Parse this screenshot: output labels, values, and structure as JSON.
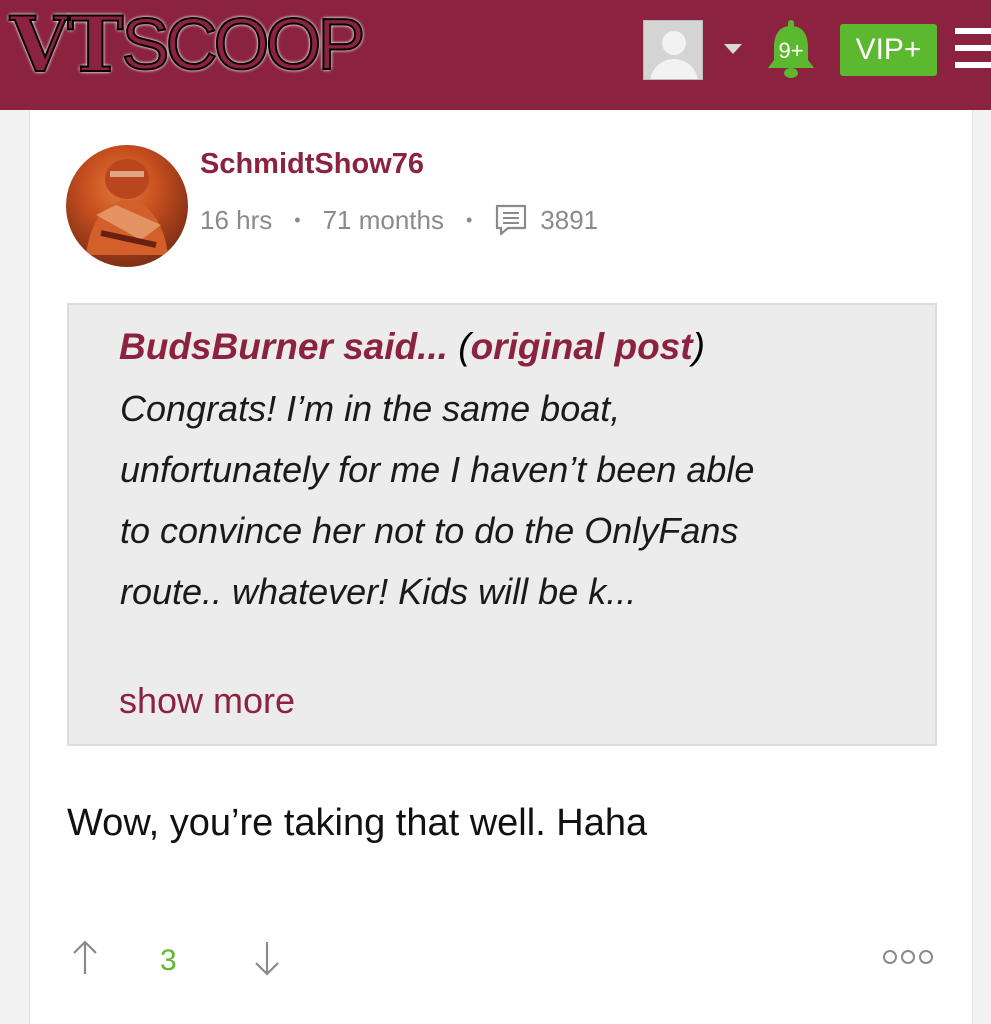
{
  "header": {
    "logo_part1": "VT",
    "logo_part2": "SCOOP",
    "notification_count": "9+",
    "vip_label": "VIP+",
    "brand_color": "#8b2340",
    "accent_green": "#5cb82e"
  },
  "post": {
    "username": "SchmidtShow76",
    "time_ago": "16 hrs",
    "member_age": "71 months",
    "post_count": "3891",
    "quote": {
      "author_said": "BudsBurner said... ",
      "open_paren": "(",
      "original_link": "original post",
      "close_paren": ")",
      "lines": [
        "Congrats! I’m in the same boat,",
        "unfortunately for me I haven’t been able",
        "to convince her not to do the OnlyFans",
        "route.. whatever! Kids will be k..."
      ],
      "show_more": "show more"
    },
    "body": "Wow, you’re taking that well. Haha",
    "vote_count": "3"
  }
}
